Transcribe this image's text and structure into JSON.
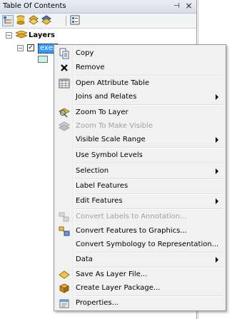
{
  "toc": {
    "title": "Table Of Contents",
    "pin_glyph": "⊣",
    "close_glyph": "×"
  },
  "toolbar": {
    "buttons": [
      "list-by-drawing-order-icon",
      "list-by-source-icon",
      "list-by-visibility-icon",
      "list-by-selection-icon",
      "options-icon"
    ]
  },
  "tree": {
    "root_label": "Layers",
    "root_expander": "−",
    "layer_expander": "−",
    "layer_name": "exer",
    "layer_checked": "✓"
  },
  "menu": {
    "items": [
      {
        "label": "Copy",
        "icon": "copy-icon",
        "enabled": true,
        "submenu": false
      },
      {
        "label": "Remove",
        "icon": "remove-icon",
        "enabled": true,
        "submenu": false
      },
      {
        "label": "Open Attribute Table",
        "icon": "attribute-table-icon",
        "enabled": true,
        "submenu": false
      },
      {
        "label": "Joins and Relates",
        "icon": "",
        "enabled": true,
        "submenu": true
      },
      {
        "label": "Zoom To Layer",
        "icon": "zoom-to-layer-icon",
        "enabled": true,
        "submenu": false
      },
      {
        "label": "Zoom To Make Visible",
        "icon": "zoom-to-make-visible-icon",
        "enabled": false,
        "submenu": false
      },
      {
        "label": "Visible Scale Range",
        "icon": "",
        "enabled": true,
        "submenu": true
      },
      {
        "label": "Use Symbol Levels",
        "icon": "",
        "enabled": true,
        "submenu": false
      },
      {
        "label": "Selection",
        "icon": "",
        "enabled": true,
        "submenu": true
      },
      {
        "label": "Label Features",
        "icon": "",
        "enabled": true,
        "submenu": false
      },
      {
        "label": "Edit Features",
        "icon": "",
        "enabled": true,
        "submenu": true
      },
      {
        "label": "Convert Labels to Annotation...",
        "icon": "convert-labels-icon",
        "enabled": false,
        "submenu": false
      },
      {
        "label": "Convert Features to Graphics...",
        "icon": "convert-graphics-icon",
        "enabled": true,
        "submenu": false
      },
      {
        "label": "Convert Symbology to Representation...",
        "icon": "",
        "enabled": true,
        "submenu": false
      },
      {
        "label": "Data",
        "icon": "",
        "enabled": true,
        "submenu": true
      },
      {
        "label": "Save As Layer File...",
        "icon": "save-layer-file-icon",
        "enabled": true,
        "submenu": false
      },
      {
        "label": "Create Layer Package...",
        "icon": "layer-package-icon",
        "enabled": true,
        "submenu": false
      },
      {
        "label": "Properties...",
        "icon": "properties-icon",
        "enabled": true,
        "submenu": false
      }
    ]
  }
}
